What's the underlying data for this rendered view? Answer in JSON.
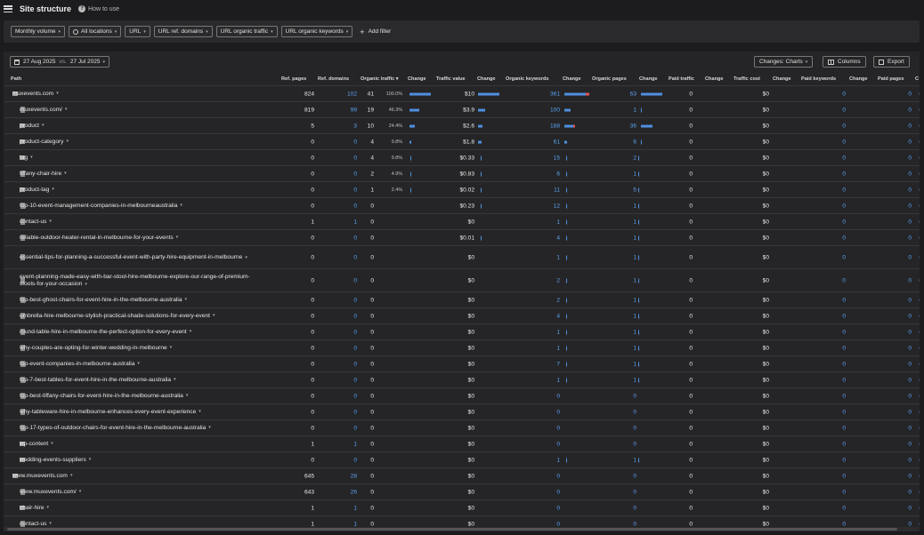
{
  "app": {
    "title": "Site structure",
    "how_to": "How to use"
  },
  "filters": {
    "monthly_volume": "Monthly volume",
    "locations": "All locations",
    "url": "URL",
    "ref_domains": "URL ref. domains",
    "organic_traffic": "URL organic traffic",
    "organic_keywords": "URL organic keywords",
    "add_filter": "Add filter"
  },
  "toolbar": {
    "date_current": "27 Aug 2025",
    "vs": "vs.",
    "date_compare": "27 Jul 2025",
    "changes": "Changes: Charts",
    "columns": "Columns",
    "export": "Export"
  },
  "columns": {
    "path": "Path",
    "ref_pages": "Ref. pages",
    "ref_domains": "Ref. domains",
    "organic_traffic": "Organic traffic",
    "change1": "Change",
    "traffic_value": "Traffic value",
    "change2": "Change",
    "organic_keywords": "Organic keywords",
    "change3": "Change",
    "organic_pages": "Organic pages",
    "change4": "Change",
    "paid_traffic": "Paid traffic",
    "change5": "Change",
    "traffic_cost": "Traffic cost",
    "change6": "Change",
    "paid_keywords": "Paid keywords",
    "change7": "Change",
    "paid_pages": "Paid pages",
    "trunc": "C"
  },
  "rows": [
    {
      "path": "muxevents.com",
      "icon": "globe",
      "expander": "v",
      "indent": 0,
      "ref_pages": "824",
      "ref_domains": "102",
      "organic_traffic": "41",
      "pct": "100.0%",
      "traffic_value": "$10",
      "organic_keywords": "361",
      "organic_pages": "63",
      "paid_traffic": "0",
      "traffic_cost": "$0",
      "paid_keywords": "0",
      "paid_pages": "0",
      "c": "0"
    },
    {
      "path": "muxevents.com/",
      "icon": "file",
      "expander": "",
      "indent": 1,
      "ref_pages": "819",
      "ref_domains": "99",
      "organic_traffic": "19",
      "pct": "46.3%",
      "traffic_value": "$3.9",
      "organic_keywords": "100",
      "organic_pages": "1",
      "paid_traffic": "0",
      "traffic_cost": "$0",
      "paid_keywords": "0",
      "paid_pages": "0",
      "c": "0"
    },
    {
      "path": "product",
      "icon": "folder",
      "expander": ">",
      "indent": 1,
      "ref_pages": "5",
      "ref_domains": "3",
      "organic_traffic": "10",
      "pct": "24.4%",
      "traffic_value": "$2.6",
      "organic_keywords": "188",
      "organic_pages": "36",
      "paid_traffic": "0",
      "traffic_cost": "$0",
      "paid_keywords": "0",
      "paid_pages": "0",
      "c": "0"
    },
    {
      "path": "product-category",
      "icon": "folder",
      "expander": ">",
      "indent": 1,
      "ref_pages": "0",
      "ref_domains": "0",
      "organic_traffic": "4",
      "pct": "9.8%",
      "traffic_value": "$1.8",
      "organic_keywords": "61",
      "organic_pages": "6",
      "paid_traffic": "0",
      "traffic_cost": "$0",
      "paid_keywords": "0",
      "paid_pages": "0",
      "c": "0"
    },
    {
      "path": "tag",
      "icon": "folder",
      "expander": ">",
      "indent": 1,
      "ref_pages": "0",
      "ref_domains": "0",
      "organic_traffic": "4",
      "pct": "9.8%",
      "traffic_value": "$0.33",
      "organic_keywords": "15",
      "organic_pages": "2",
      "paid_traffic": "0",
      "traffic_cost": "$0",
      "paid_keywords": "0",
      "paid_pages": "0",
      "c": "0"
    },
    {
      "path": "tiffany-chair-hire",
      "icon": "file",
      "expander": "",
      "indent": 1,
      "ref_pages": "0",
      "ref_domains": "0",
      "organic_traffic": "2",
      "pct": "4.9%",
      "traffic_value": "$0.83",
      "organic_keywords": "6",
      "organic_pages": "1",
      "paid_traffic": "0",
      "traffic_cost": "$0",
      "paid_keywords": "0",
      "paid_pages": "0",
      "c": "0"
    },
    {
      "path": "product-tag",
      "icon": "folder",
      "expander": ">",
      "indent": 1,
      "ref_pages": "0",
      "ref_domains": "0",
      "organic_traffic": "1",
      "pct": "2.4%",
      "traffic_value": "$0.02",
      "organic_keywords": "11",
      "organic_pages": "5",
      "paid_traffic": "0",
      "traffic_cost": "$0",
      "paid_keywords": "0",
      "paid_pages": "0",
      "c": "0"
    },
    {
      "path": "top-10-event-management-companies-in-melbourneaustralia",
      "icon": "file",
      "expander": "",
      "indent": 1,
      "ref_pages": "0",
      "ref_domains": "0",
      "organic_traffic": "0",
      "pct": "",
      "traffic_value": "$0.23",
      "organic_keywords": "12",
      "organic_pages": "1",
      "paid_traffic": "0",
      "traffic_cost": "$0",
      "paid_keywords": "0",
      "paid_pages": "0",
      "c": "0"
    },
    {
      "path": "contact-us",
      "icon": "file",
      "expander": "",
      "indent": 1,
      "ref_pages": "1",
      "ref_domains": "1",
      "organic_traffic": "0",
      "pct": "",
      "traffic_value": "$0",
      "organic_keywords": "1",
      "organic_pages": "1",
      "paid_traffic": "0",
      "traffic_cost": "$0",
      "paid_keywords": "0",
      "paid_pages": "0",
      "c": "0"
    },
    {
      "path": "reliable-outdoor-heater-rental-in-melbourne-for-your-events",
      "icon": "file",
      "expander": "",
      "indent": 1,
      "ref_pages": "0",
      "ref_domains": "0",
      "organic_traffic": "0",
      "pct": "",
      "traffic_value": "$0.01",
      "organic_keywords": "4",
      "organic_pages": "1",
      "paid_traffic": "0",
      "traffic_cost": "$0",
      "paid_keywords": "0",
      "paid_pages": "0",
      "c": "0"
    },
    {
      "path": "essential-tips-for-planning-a-successful-event-with-party-hire-equipment-in-melbourne",
      "icon": "file",
      "expander": "",
      "indent": 1,
      "tall": true,
      "ref_pages": "0",
      "ref_domains": "0",
      "organic_traffic": "0",
      "pct": "",
      "traffic_value": "$0",
      "organic_keywords": "1",
      "organic_pages": "1",
      "paid_traffic": "0",
      "traffic_cost": "$0",
      "paid_keywords": "0",
      "paid_pages": "0",
      "c": "0"
    },
    {
      "path": "event-planning-made-easy-with-bar-stool-hire-melbourne-explore-our-range-of-premium-stools-for-your-occasion",
      "icon": "file",
      "expander": "",
      "indent": 1,
      "tall": true,
      "ref_pages": "0",
      "ref_domains": "0",
      "organic_traffic": "0",
      "pct": "",
      "traffic_value": "$0",
      "organic_keywords": "2",
      "organic_pages": "1",
      "paid_traffic": "0",
      "traffic_cost": "$0",
      "paid_keywords": "0",
      "paid_pages": "0",
      "c": "0"
    },
    {
      "path": "top-best-ghost-chairs-for-event-hire-in-the-melbourne-australia",
      "icon": "file",
      "expander": "",
      "indent": 1,
      "ref_pages": "0",
      "ref_domains": "0",
      "organic_traffic": "0",
      "pct": "",
      "traffic_value": "$0",
      "organic_keywords": "2",
      "organic_pages": "1",
      "paid_traffic": "0",
      "traffic_cost": "$0",
      "paid_keywords": "0",
      "paid_pages": "0",
      "c": "0"
    },
    {
      "path": "umbrella-hire-melbourne-stylish-practical-shade-solutions-for-every-event",
      "icon": "file",
      "expander": "",
      "indent": 1,
      "ref_pages": "0",
      "ref_domains": "0",
      "organic_traffic": "0",
      "pct": "",
      "traffic_value": "$0",
      "organic_keywords": "4",
      "organic_pages": "1",
      "paid_traffic": "0",
      "traffic_cost": "$0",
      "paid_keywords": "0",
      "paid_pages": "0",
      "c": "0"
    },
    {
      "path": "round-table-hire-in-melbourne-the-perfect-option-for-every-event",
      "icon": "file",
      "expander": "",
      "indent": 1,
      "ref_pages": "0",
      "ref_domains": "0",
      "organic_traffic": "0",
      "pct": "",
      "traffic_value": "$0",
      "organic_keywords": "1",
      "organic_pages": "1",
      "paid_traffic": "0",
      "traffic_cost": "$0",
      "paid_keywords": "0",
      "paid_pages": "0",
      "c": "0"
    },
    {
      "path": "why-couples-are-opting-for-winter-wedding-in-melbourne",
      "icon": "file",
      "expander": "",
      "indent": 1,
      "ref_pages": "0",
      "ref_domains": "0",
      "organic_traffic": "0",
      "pct": "",
      "traffic_value": "$0",
      "organic_keywords": "1",
      "organic_pages": "1",
      "paid_traffic": "0",
      "traffic_cost": "$0",
      "paid_keywords": "0",
      "paid_pages": "0",
      "c": "0"
    },
    {
      "path": "top-event-companies-in-melbourne-australia",
      "icon": "file",
      "expander": "",
      "indent": 1,
      "ref_pages": "0",
      "ref_domains": "0",
      "organic_traffic": "0",
      "pct": "",
      "traffic_value": "$0",
      "organic_keywords": "7",
      "organic_pages": "1",
      "paid_traffic": "0",
      "traffic_cost": "$0",
      "paid_keywords": "0",
      "paid_pages": "0",
      "c": "0"
    },
    {
      "path": "top-7-best-tables-for-event-hire-in-the-melbourne-australia",
      "icon": "file",
      "expander": "",
      "indent": 1,
      "ref_pages": "0",
      "ref_domains": "0",
      "organic_traffic": "0",
      "pct": "",
      "traffic_value": "$0",
      "organic_keywords": "1",
      "organic_pages": "1",
      "paid_traffic": "0",
      "traffic_cost": "$0",
      "paid_keywords": "0",
      "paid_pages": "0",
      "c": "0"
    },
    {
      "path": "top-best-tiffany-chairs-for-event-hire-in-the-melbourne-australia",
      "icon": "file",
      "expander": "",
      "indent": 1,
      "ref_pages": "0",
      "ref_domains": "0",
      "organic_traffic": "0",
      "pct": "",
      "traffic_value": "$0",
      "organic_keywords": "0",
      "organic_pages": "0",
      "paid_traffic": "0",
      "traffic_cost": "$0",
      "paid_keywords": "0",
      "paid_pages": "0",
      "c": "0"
    },
    {
      "path": "why-tableware-hire-in-melbourne-enhances-every-event-experience",
      "icon": "file",
      "expander": "",
      "indent": 1,
      "ref_pages": "0",
      "ref_domains": "0",
      "organic_traffic": "0",
      "pct": "",
      "traffic_value": "$0",
      "organic_keywords": "0",
      "organic_pages": "0",
      "paid_traffic": "0",
      "traffic_cost": "$0",
      "paid_keywords": "0",
      "paid_pages": "0",
      "c": "0"
    },
    {
      "path": "top-17-types-of-outdoor-chairs-for-event-hire-in-the-melbourne-australia",
      "icon": "file",
      "expander": "",
      "indent": 1,
      "ref_pages": "0",
      "ref_domains": "0",
      "organic_traffic": "0",
      "pct": "",
      "traffic_value": "$0",
      "organic_keywords": "0",
      "organic_pages": "0",
      "paid_traffic": "0",
      "traffic_cost": "$0",
      "paid_keywords": "0",
      "paid_pages": "0",
      "c": "0"
    },
    {
      "path": "wp-content",
      "icon": "folder",
      "expander": ">",
      "indent": 1,
      "ref_pages": "1",
      "ref_domains": "1",
      "organic_traffic": "0",
      "pct": "",
      "traffic_value": "$0",
      "organic_keywords": "0",
      "organic_pages": "0",
      "paid_traffic": "0",
      "traffic_cost": "$0",
      "paid_keywords": "0",
      "paid_pages": "0",
      "c": "0"
    },
    {
      "path": "wedding-events-suppliers",
      "icon": "folder",
      "expander": ">",
      "indent": 1,
      "ref_pages": "0",
      "ref_domains": "0",
      "organic_traffic": "0",
      "pct": "",
      "traffic_value": "$0",
      "organic_keywords": "1",
      "organic_pages": "1",
      "paid_traffic": "0",
      "traffic_cost": "$0",
      "paid_keywords": "0",
      "paid_pages": "0",
      "c": "0"
    },
    {
      "path": "www.muxevents.com",
      "icon": "globe",
      "expander": "v",
      "indent": 0,
      "ref_pages": "645",
      "ref_domains": "28",
      "organic_traffic": "0",
      "pct": "",
      "traffic_value": "$0",
      "organic_keywords": "0",
      "organic_pages": "0",
      "paid_traffic": "0",
      "traffic_cost": "$0",
      "paid_keywords": "0",
      "paid_pages": "0",
      "c": "0"
    },
    {
      "path": "www.muxevents.com/",
      "icon": "file",
      "expander": "",
      "indent": 1,
      "ref_pages": "643",
      "ref_domains": "26",
      "organic_traffic": "0",
      "pct": "",
      "traffic_value": "$0",
      "organic_keywords": "0",
      "organic_pages": "0",
      "paid_traffic": "0",
      "traffic_cost": "$0",
      "paid_keywords": "0",
      "paid_pages": "0",
      "c": "0"
    },
    {
      "path": "chair-hire",
      "icon": "folder",
      "expander": ">",
      "indent": 1,
      "ref_pages": "1",
      "ref_domains": "1",
      "organic_traffic": "0",
      "pct": "",
      "traffic_value": "$0",
      "organic_keywords": "0",
      "organic_pages": "0",
      "paid_traffic": "0",
      "traffic_cost": "$0",
      "paid_keywords": "0",
      "paid_pages": "0",
      "c": "0"
    },
    {
      "path": "contact-us",
      "icon": "file",
      "expander": "",
      "indent": 1,
      "ref_pages": "1",
      "ref_domains": "1",
      "organic_traffic": "0",
      "pct": "",
      "traffic_value": "$0",
      "organic_keywords": "0",
      "organic_pages": "0",
      "paid_traffic": "0",
      "traffic_cost": "$0",
      "paid_keywords": "0",
      "paid_pages": "0",
      "c": "0"
    }
  ],
  "colors": {
    "accent_blue": "#5aa2f0",
    "bar_blue": "#4f8fe0",
    "bar_red": "#e25555",
    "bar_green": "#3bbf7a",
    "background": "#1c1c1e",
    "panel": "#252527"
  }
}
